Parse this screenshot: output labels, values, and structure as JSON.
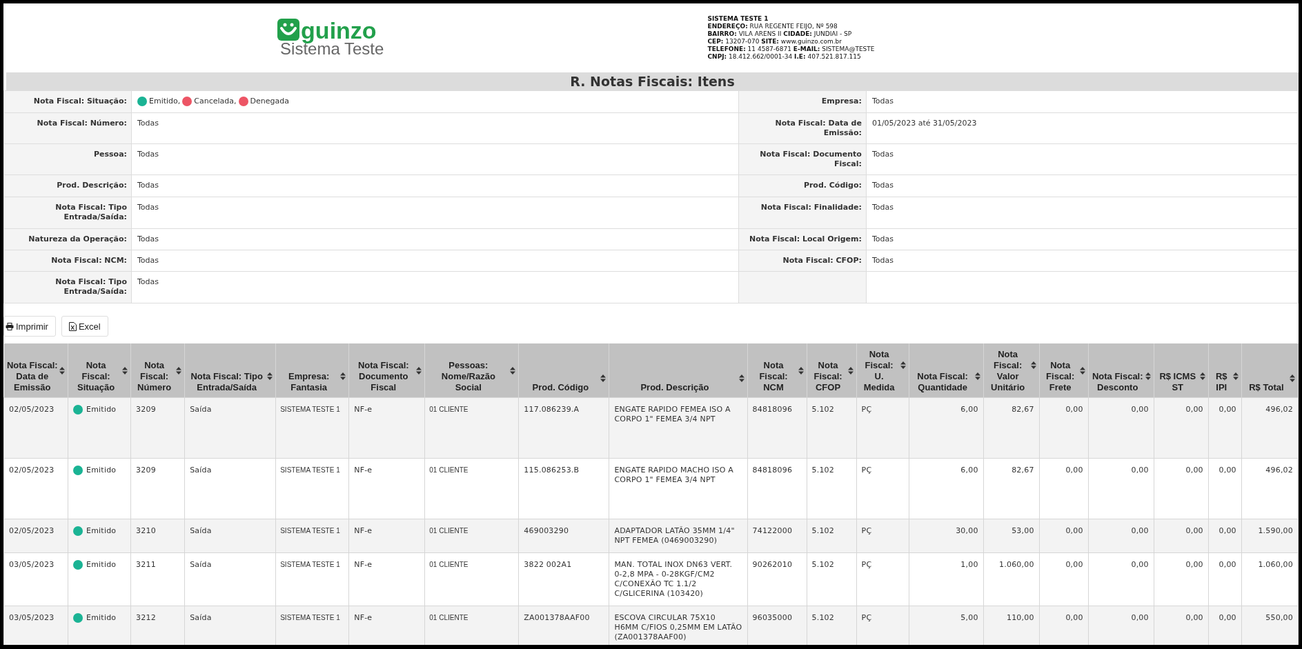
{
  "header": {
    "logo": {
      "brand": "guinzo",
      "subtitle": "Sistema Teste"
    },
    "company": [
      "SISTEMA TESTE 1",
      "**ENDEREÇO:** RUA REGENTE FEIJO, Nº 598",
      "**BAIRRO:** VILA ARENS II **CIDADE:** JUNDIAI - SP",
      "**CEP:** 13207-070 **SITE:** www.guinzo.com.br",
      "**TELEFONE:** 11 4587-6871 **E-MAIL:** SISTEMA@TESTE",
      "**CNPJ:** 18.412.662/0001-34 **I.E:** 407.521.817.115"
    ]
  },
  "title": "R. Notas Fiscais: Itens",
  "filters": [
    {
      "left": {
        "label": "Nota Fiscal: Situação:",
        "legend": [
          {
            "label": "Emitido,",
            "color": "#1ab394"
          },
          {
            "label": "Cancelada,",
            "color": "#ed5565"
          },
          {
            "label": "Denegada",
            "color": "#ed5565"
          }
        ]
      },
      "right": {
        "label": "Empresa:",
        "value": "Todas"
      }
    },
    {
      "left": {
        "label": "Nota Fiscal: Número:",
        "value": "Todas"
      },
      "right": {
        "label": "Nota Fiscal: Data de Emissão:",
        "value": "01/05/2023 até 31/05/2023"
      }
    },
    {
      "left": {
        "label": "Pessoa:",
        "value": "Todas"
      },
      "right": {
        "label": "Nota Fiscal: Documento Fiscal:",
        "value": "Todas"
      }
    },
    {
      "left": {
        "label": "Prod. Descrição:",
        "value": "Todas"
      },
      "right": {
        "label": "Prod. Código:",
        "value": "Todas"
      }
    },
    {
      "left": {
        "label": "Nota Fiscal: Tipo Entrada/Saída:",
        "value": "Todas"
      },
      "right": {
        "label": "Nota Fiscal: Finalidade:",
        "value": "Todas"
      }
    },
    {
      "left": {
        "label": "Natureza da Operação:",
        "value": "Todas"
      },
      "right": {
        "label": "Nota Fiscal: Local Origem:",
        "value": "Todas"
      }
    },
    {
      "left": {
        "label": "Nota Fiscal: NCM:",
        "value": "Todas"
      },
      "right": {
        "label": "Nota Fiscal: CFOP:",
        "value": "Todas"
      }
    },
    {
      "left": {
        "label": "Nota Fiscal: Tipo Entrada/Saída:",
        "value": "Todas"
      }
    }
  ],
  "buttons": [
    {
      "kind": "print",
      "label": "Imprimir"
    },
    {
      "kind": "excel",
      "label": "Excel"
    }
  ],
  "table": {
    "columns": [
      {
        "label": "Nota Fiscal: Data de Emissão",
        "kind": "text"
      },
      {
        "label": "Nota Fiscal: Situação",
        "kind": "status"
      },
      {
        "label": "Nota Fiscal: Número",
        "kind": "text"
      },
      {
        "label": "Nota Fiscal: Tipo Entrada/Saída",
        "kind": "text"
      },
      {
        "label": "Empresa: Fantasia",
        "kind": "small"
      },
      {
        "label": "Nota Fiscal: Documento Fiscal",
        "kind": "text"
      },
      {
        "label": "Pessoas: Nome/Razão Social",
        "kind": "small"
      },
      {
        "label": "Prod. Código",
        "kind": "text"
      },
      {
        "label": "Prod. Descrição",
        "kind": "text"
      },
      {
        "label": "Nota Fiscal: NCM",
        "kind": "text"
      },
      {
        "label": "Nota Fiscal: CFOP",
        "kind": "text"
      },
      {
        "label": "Nota Fiscal: U. Medida",
        "kind": "text"
      },
      {
        "label": "Nota Fiscal: Quantidade",
        "kind": "number"
      },
      {
        "label": "Nota Fiscal: Valor Unitário",
        "kind": "number"
      },
      {
        "label": "Nota Fiscal: Frete",
        "kind": "number"
      },
      {
        "label": "Nota Fiscal: Desconto",
        "kind": "number"
      },
      {
        "label": "R$ ICMS ST",
        "kind": "number"
      },
      {
        "label": "R$ IPI",
        "kind": "number"
      },
      {
        "label": "R$ Total",
        "kind": "number"
      }
    ],
    "rows": [
      {
        "color": "#1ab394",
        "cells": [
          "02/05/2023",
          "Emitido",
          "3209",
          "Saída",
          "SISTEMA TESTE 1",
          "NF-e",
          "01 CLIENTE",
          "117.086239.A",
          "ENGATE RAPIDO FEMEA ISO A CORPO 1\" FEMEA 3/4 NPT",
          "84818096",
          "5.102",
          "PÇ",
          "6,00",
          "82,67",
          "0,00",
          "0,00",
          "0,00",
          "0,00",
          "496,02"
        ]
      },
      {
        "color": "#1ab394",
        "cells": [
          "02/05/2023",
          "Emitido",
          "3209",
          "Saída",
          "SISTEMA TESTE 1",
          "NF-e",
          "01 CLIENTE",
          "115.086253.B",
          "ENGATE RAPIDO MACHO ISO A CORPO 1\" FEMEA 3/4 NPT",
          "84818096",
          "5.102",
          "PÇ",
          "6,00",
          "82,67",
          "0,00",
          "0,00",
          "0,00",
          "0,00",
          "496,02"
        ]
      },
      {
        "color": "#1ab394",
        "cells": [
          "02/05/2023",
          "Emitido",
          "3210",
          "Saída",
          "SISTEMA TESTE 1",
          "NF-e",
          "01 CLIENTE",
          "469003290",
          "ADAPTADOR LATÃO 35MM 1/4\" NPT FEMEA (0469003290)",
          "74122000",
          "5.102",
          "PÇ",
          "30,00",
          "53,00",
          "0,00",
          "0,00",
          "0,00",
          "0,00",
          "1.590,00"
        ]
      },
      {
        "color": "#1ab394",
        "cells": [
          "03/05/2023",
          "Emitido",
          "3211",
          "Saída",
          "SISTEMA TESTE 1",
          "NF-e",
          "01 CLIENTE",
          "3822 002A1",
          "MAN. TOTAL INOX DN63 VERT. 0-2,8 MPA - 0-28KGF/CM2 C/CONEXÃO TC 1.1/2 C/GLICERINA (103420)",
          "90262010",
          "5.102",
          "PÇ",
          "1,00",
          "1.060,00",
          "0,00",
          "0,00",
          "0,00",
          "0,00",
          "1.060,00"
        ]
      },
      {
        "color": "#1ab394",
        "cells": [
          "03/05/2023",
          "Emitido",
          "3212",
          "Saída",
          "SISTEMA TESTE 1",
          "NF-e",
          "01 CLIENTE",
          "ZA001378AAF00",
          "ESCOVA CIRCULAR 75X10 H6MM C/FIOS 0,25MM EM LATÃO (ZA001378AAF00)",
          "96035000",
          "5.102",
          "PÇ",
          "5,00",
          "110,00",
          "0,00",
          "0,00",
          "0,00",
          "0,00",
          "550,00"
        ]
      }
    ]
  }
}
